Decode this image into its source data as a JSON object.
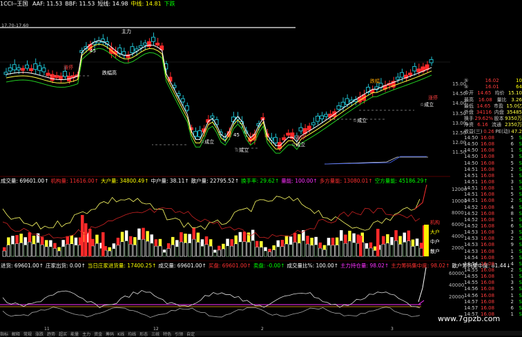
{
  "topbar": {
    "title": "1CCI--王国",
    "items": [
      {
        "label": "AAF: 11.53",
        "color": "#ffffff"
      },
      {
        "label": "BBF: 11.53",
        "color": "#ffffff"
      },
      {
        "label": "短线: 14.98",
        "color": "#ffffff"
      },
      {
        "label": "中线: 14.81",
        "color": "#ffff00"
      },
      {
        "label": "下跌",
        "color": "#00ff00"
      }
    ]
  },
  "main_chart": {
    "range_label": "17.70-17.60",
    "y_ticks": [
      "15.00",
      "14.50",
      "14.00",
      "13.50",
      "13.00",
      "12.50",
      "12.00",
      "11.50"
    ],
    "annotations": [
      {
        "text": "主力",
        "color": "#ffffff"
      },
      {
        "text": "45",
        "color": "#ffffff"
      },
      {
        "text": "涨停",
        "color": "#ff4040"
      },
      {
        "text": "跌幅高",
        "color": "#ffffff"
      },
      {
        "text": "45",
        "color": "#ffffff"
      },
      {
        "text": "☆成立",
        "color": "#ffffff"
      },
      {
        "text": "☆成立",
        "color": "#ffffff"
      },
      {
        "text": "☆成立",
        "color": "#ffffff"
      },
      {
        "text": "☆成立",
        "color": "#ffffff"
      },
      {
        "text": "☆成立",
        "color": "#ffffff"
      },
      {
        "text": "涨停",
        "color": "#ff4040"
      },
      {
        "text": "涨停",
        "color": "#ff4040"
      },
      {
        "text": "跌幅",
        "color": "#ffaa00"
      }
    ]
  },
  "indicator1": {
    "legend": [
      {
        "text": "成交量: 69601.00↑",
        "color": "#ffffff"
      },
      {
        "text": "机构量: 11616.00↑",
        "color": "#ff3030"
      },
      {
        "text": "大户量: 34800.49↑",
        "color": "#ffff00"
      },
      {
        "text": "中户量: 38.11↑",
        "color": "#ffffff"
      },
      {
        "text": "散户量: 22795.52↑",
        "color": "#ffffff"
      },
      {
        "text": "换手率: 29.62↑",
        "color": "#00ff00"
      },
      {
        "text": "量能: 100.00↑",
        "color": "#ff30ff"
      },
      {
        "text": "多方量能: 13080.01↑",
        "color": "#ff3030"
      },
      {
        "text": "空方量能: 45186.29↑",
        "color": "#00ff00"
      }
    ],
    "y_ticks": [
      "12000",
      "10000",
      "8000",
      "6000",
      "4000",
      "2000"
    ],
    "side_labels": [
      {
        "text": "机构",
        "color": "#ff3030"
      },
      {
        "text": "大户",
        "color": "#ffff00"
      },
      {
        "text": "中户",
        "color": "#ffffff"
      },
      {
        "text": "散户",
        "color": "#ffffff"
      }
    ]
  },
  "indicator2": {
    "legend": [
      {
        "text": "进货: 69601.00↑",
        "color": "#ffffff"
      },
      {
        "text": "庄家出货: 0.00↑",
        "color": "#ffffff"
      },
      {
        "text": "当日庄家进货量: 17400.25↑",
        "color": "#ffff00"
      },
      {
        "text": "成交量: 69601.00↑",
        "color": "#ffffff"
      },
      {
        "text": "买盘: 69601.00↑",
        "color": "#ff3030"
      },
      {
        "text": "卖盘: -0.00↑",
        "color": "#00ff00"
      },
      {
        "text": "成交量比%: 100.00↑",
        "color": "#ffffff"
      },
      {
        "text": "主力持仓量: 98.02↑",
        "color": "#ff30ff"
      },
      {
        "text": "主力筹码集中度: 98.02↑",
        "color": "#ff3030"
      },
      {
        "text": "散户筹码集中度: 81.44↓",
        "color": "#ffffff"
      }
    ],
    "y_ticks": [
      "60000",
      "40000",
      "20000"
    ]
  },
  "time_axis": [
    "11",
    "12",
    "2",
    "3"
  ],
  "quote": {
    "sell": [
      {
        "label": "⑤",
        "price": "16.02",
        "vol": "10"
      },
      {
        "label": "⑤",
        "price": "16.01",
        "vol": "64"
      }
    ],
    "rows": [
      {
        "label": "今开",
        "value": "14.65",
        "label2": "均价",
        "value2": "15.10"
      },
      {
        "label": "最高",
        "value": "16.08",
        "label2": "量比",
        "value2": "3.26"
      },
      {
        "label": "最低",
        "value": "14.65",
        "label2": "市盈",
        "value2": "15.0亿"
      },
      {
        "label": "外盘",
        "value": "34116",
        "label2": "内盘",
        "value2": "35485"
      },
      {
        "label": "换手",
        "value": "29.62%",
        "label2": "股本",
        "value2": "9350万"
      },
      {
        "label": "净资",
        "value": "6.16",
        "label2": "流通",
        "value2": "2350万"
      },
      {
        "label": "收益(三)",
        "value": "0.26",
        "label2": "PE(动)",
        "value2": "47.2"
      }
    ]
  },
  "trades": [
    {
      "time": "14:50",
      "price": "16.08",
      "vol": "5",
      "side": "S"
    },
    {
      "time": "14:50",
      "price": "16.08",
      "vol": "6",
      "side": "S"
    },
    {
      "time": "14:50",
      "price": "16.08",
      "vol": "1",
      "side": "S"
    },
    {
      "time": "14:50",
      "price": "16.08",
      "vol": "3",
      "side": "S"
    },
    {
      "time": "14:50",
      "price": "16.08",
      "vol": "5",
      "side": "S"
    },
    {
      "time": "14:51",
      "price": "16.08",
      "vol": "2",
      "side": "S"
    },
    {
      "time": "14:51",
      "price": "16.08",
      "vol": "1",
      "side": "S"
    },
    {
      "time": "14:51",
      "price": "16.08",
      "vol": "3",
      "side": "S"
    },
    {
      "time": "14:51",
      "price": "16.08",
      "vol": "1",
      "side": "S"
    },
    {
      "time": "14:51",
      "price": "16.08",
      "vol": "5",
      "side": "S"
    },
    {
      "time": "14:51",
      "price": "16.08",
      "vol": "2",
      "side": "S"
    },
    {
      "time": "14:52",
      "price": "16.08",
      "vol": "4",
      "side": "S"
    },
    {
      "time": "14:52",
      "price": "16.08",
      "vol": "8",
      "side": "S"
    },
    {
      "time": "14:52",
      "price": "16.08",
      "vol": "1",
      "side": "S"
    },
    {
      "time": "14:52",
      "price": "16.08",
      "vol": "6",
      "side": "S"
    },
    {
      "time": "14:53",
      "price": "16.08",
      "vol": "3",
      "side": "S"
    },
    {
      "time": "14:53",
      "price": "16.08",
      "vol": "2",
      "side": "S"
    },
    {
      "time": "14:53",
      "price": "16.08",
      "vol": "9",
      "side": "S"
    },
    {
      "time": "14:53",
      "price": "16.08",
      "vol": "1",
      "side": "S"
    },
    {
      "time": "14:54",
      "price": "16.08",
      "vol": "5",
      "side": "S"
    },
    {
      "time": "14:54",
      "price": "16.08",
      "vol": "4",
      "side": "S"
    },
    {
      "time": "14:55",
      "price": "16.08",
      "vol": "2",
      "side": "S"
    },
    {
      "time": "14:55",
      "price": "16.08",
      "vol": "1",
      "side": "S"
    },
    {
      "time": "14:55",
      "price": "16.08",
      "vol": "3",
      "side": "S"
    },
    {
      "time": "14:56",
      "price": "16.08",
      "vol": "5",
      "side": "S"
    },
    {
      "time": "14:56",
      "price": "16.08",
      "vol": "1",
      "side": "S"
    },
    {
      "time": "14:57",
      "price": "16.08",
      "vol": "2",
      "side": "S"
    },
    {
      "time": "14:57",
      "price": "16.08",
      "vol": "6",
      "side": "S"
    },
    {
      "time": "14:57",
      "price": "16.08",
      "vol": "1",
      "side": "S"
    }
  ],
  "watermark": "www.7gpzb.com",
  "bottombar": [
    "指标",
    "解释",
    "常规",
    "涨跌",
    "趋势",
    "超买",
    "能量",
    "主力",
    "资金",
    "筹码",
    "K线",
    "均线",
    "形态",
    "三统",
    "特色",
    "引领",
    "自定"
  ]
}
